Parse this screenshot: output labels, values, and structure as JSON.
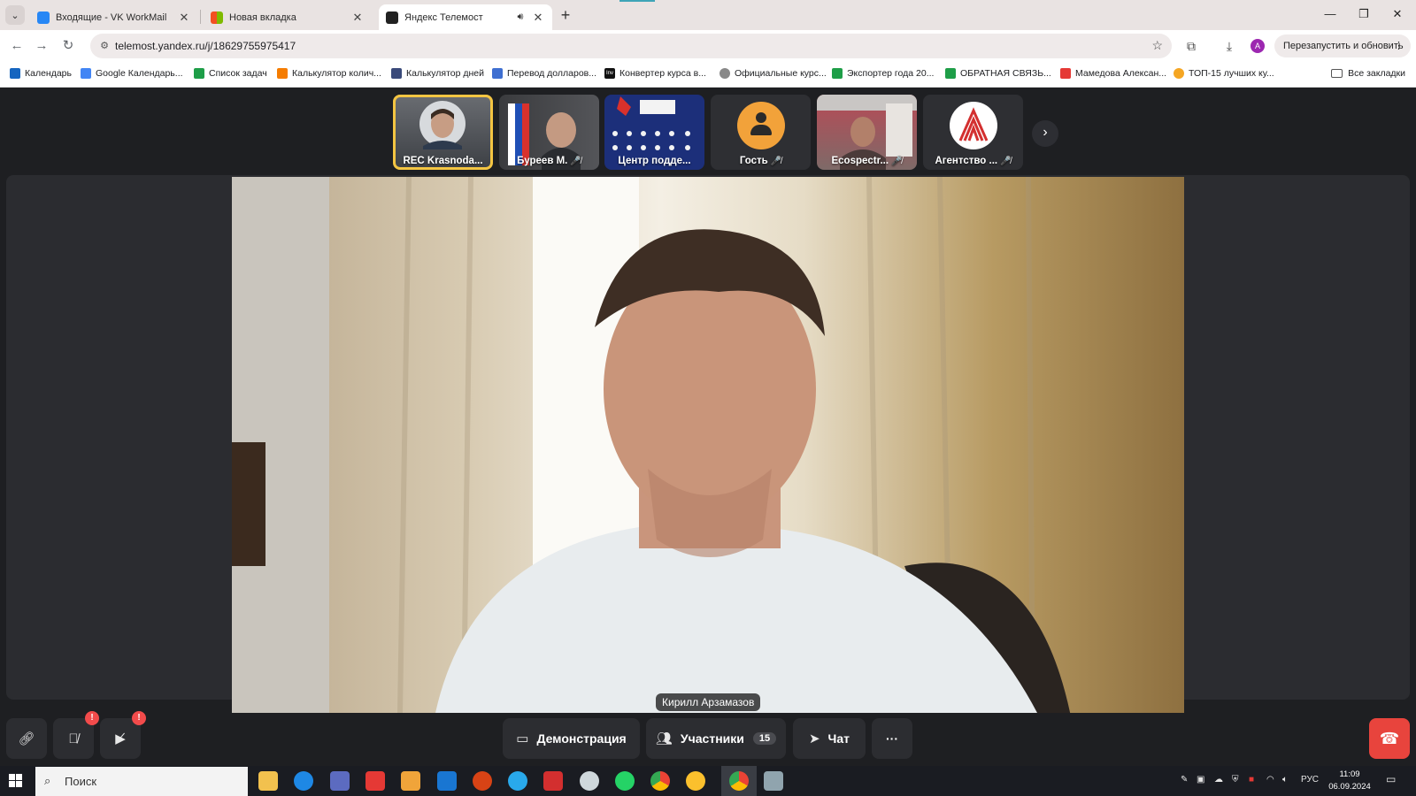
{
  "browser": {
    "tabs": [
      {
        "title": "Входящие - VK WorkMail"
      },
      {
        "title": "Новая вкладка"
      },
      {
        "title": "Яндекс Телемост"
      }
    ],
    "url": "telemost.yandex.ru/j/18629755975417",
    "profile_initial": "A",
    "relaunch_label": "Перезапустить и обновить",
    "bookmarks": [
      "Календарь",
      "Google Календарь...",
      "Список задач",
      "Калькулятор колич...",
      "Калькулятор дней",
      "Перевод долларов...",
      "Конвертер курса в...",
      "Официальные курс...",
      "Экспортер года 20...",
      "ОБРАТНАЯ СВЯЗЬ...",
      "Мамедова Алексан...",
      "ТОП-15 лучших ку..."
    ],
    "all_bookmarks": "Все закладки",
    "bookmark_icon_text": "Inv"
  },
  "call": {
    "participants": [
      {
        "label": "REC Krasnoda...",
        "muted": ""
      },
      {
        "label": "Буреев М.",
        "muted": "🎤̸"
      },
      {
        "label": "Центр подде...",
        "muted": ""
      },
      {
        "label": "Гость",
        "muted": "🎤̸"
      },
      {
        "label": "Ecospectr...",
        "muted": "🎤̸"
      },
      {
        "label": "Агентство ...",
        "muted": "🎤̸"
      }
    ],
    "main_speaker": "Кирилл Арзамазов",
    "controls": {
      "alert": "!",
      "share_label": "Демонстрация",
      "participants_label": "Участники",
      "participants_count": "15",
      "chat_label": "Чат",
      "more_label": "···"
    }
  },
  "taskbar": {
    "search_placeholder": "Поиск",
    "lang": "РУС",
    "time": "11:09",
    "date": "06.09.2024"
  }
}
